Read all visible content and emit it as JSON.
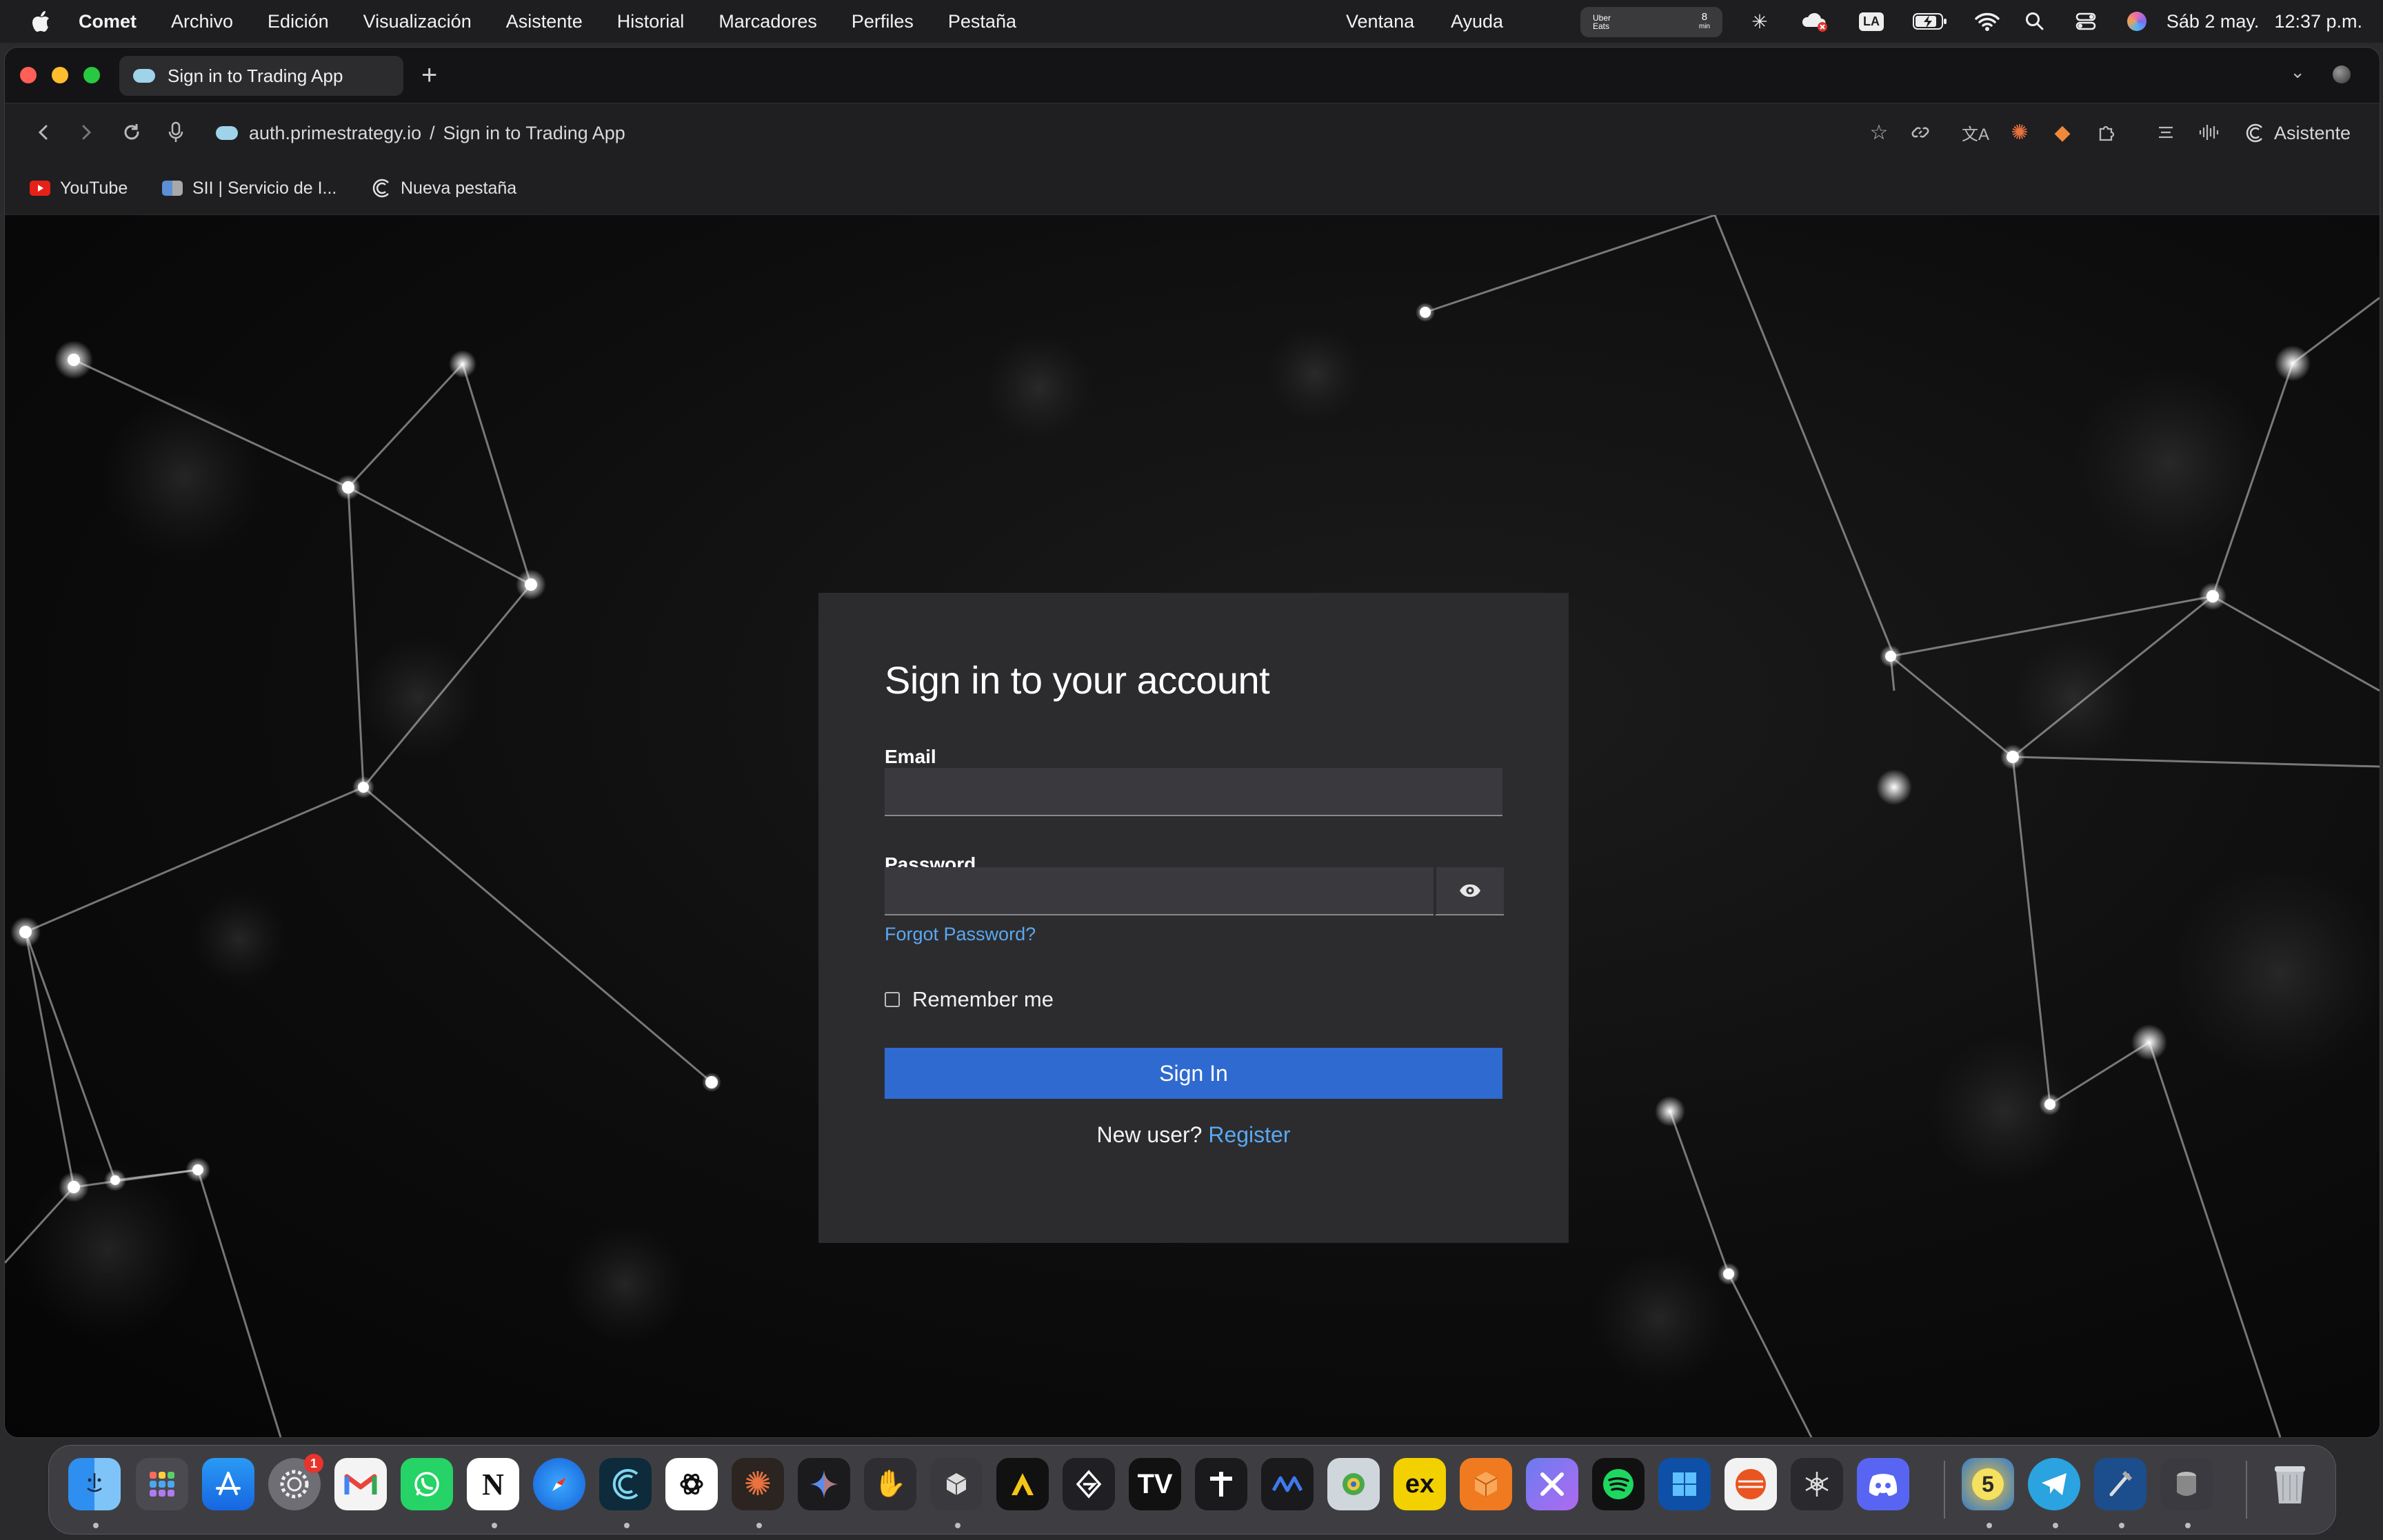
{
  "menubar": {
    "app_name": "Comet",
    "items": [
      "Archivo",
      "Edición",
      "Visualización",
      "Asistente",
      "Historial",
      "Marcadores",
      "Perfiles",
      "Pestaña"
    ],
    "right_items": [
      "Ventana",
      "Ayuda"
    ],
    "uber_label": "Uber Eats",
    "uber_count": "8",
    "uber_unit": "min",
    "keyboard_layout": "LA",
    "date": "Sáb 2 may.",
    "time": "12:37 p.m."
  },
  "tab": {
    "title": "Sign in to Trading App",
    "new_tab_symbol": "+"
  },
  "toolbar": {
    "url_host": "auth.primestrategy.io",
    "url_separator": "/",
    "url_page": "Sign in to Trading App",
    "assistant_label": "Asistente"
  },
  "bookmarks": [
    {
      "label": "YouTube",
      "icon": "youtube-icon"
    },
    {
      "label": "SII | Servicio de I...",
      "icon": "sii-icon"
    },
    {
      "label": "Nueva pestaña",
      "icon": "comet-icon"
    }
  ],
  "login": {
    "heading": "Sign in to your account",
    "email_label": "Email",
    "email_value": "",
    "password_label": "Password",
    "password_value": "",
    "forgot_label": "Forgot Password?",
    "remember_label": "Remember me",
    "remember_checked": false,
    "submit_label": "Sign In",
    "new_user_text": "New user?",
    "register_label": "Register"
  },
  "colors": {
    "card_bg": "#2c2c2f",
    "primary_button": "#2f6ad0",
    "link": "#5aa8f0"
  },
  "dock": {
    "apps": [
      "finder",
      "launchpad",
      "app-store",
      "system-settings",
      "gmail",
      "whatsapp",
      "notion",
      "safari",
      "comet",
      "chatgpt",
      "claude",
      "gemini",
      "hand-app",
      "cube-app",
      "arc-app",
      "cursor",
      "tradingview",
      "plus-app",
      "meta-app",
      "preview",
      "excalidraw",
      "box-app",
      "perplexity",
      "spotify",
      "windows-app",
      "ubuntu",
      "network-app",
      "discord",
      "metatrader-5",
      "telegram",
      "xcode",
      "disk-utility",
      "trash"
    ],
    "settings_badge": "1"
  }
}
